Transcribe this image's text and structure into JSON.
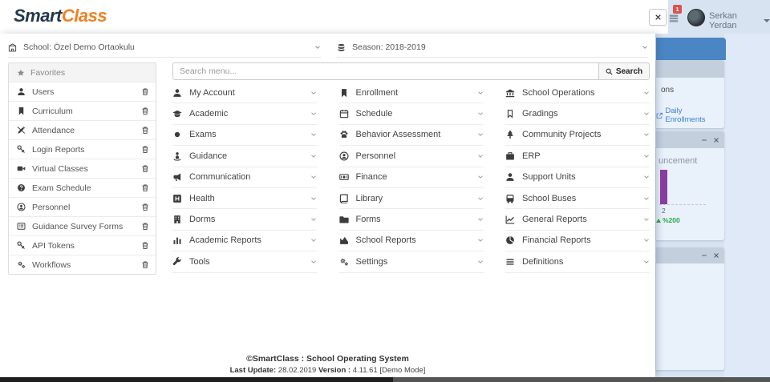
{
  "header": {
    "logo_part1": "Smart",
    "logo_part2": "Class",
    "user_name": "Serkan Yerdan",
    "notification_count": "1"
  },
  "context": {
    "school_label": "School: Özel Demo Ortaokulu",
    "season_label": "Season: 2018-2019"
  },
  "favorites": {
    "title": "Favorites",
    "items": [
      {
        "label": "Users",
        "icon": "user"
      },
      {
        "label": "Curriculum",
        "icon": "bookmark"
      },
      {
        "label": "Attendance",
        "icon": "pencil-slash"
      },
      {
        "label": "Login Reports",
        "icon": "key"
      },
      {
        "label": "Virtual Classes",
        "icon": "video"
      },
      {
        "label": "Exam Schedule",
        "icon": "question-circle"
      },
      {
        "label": "Personnel",
        "icon": "user-circle"
      },
      {
        "label": "Guidance Survey Forms",
        "icon": "list-alt"
      },
      {
        "label": "API Tokens",
        "icon": "key"
      },
      {
        "label": "Workflows",
        "icon": "cogs"
      }
    ]
  },
  "search": {
    "placeholder": "Search menu...",
    "button_label": "Search"
  },
  "menu": {
    "items": [
      {
        "label": "My Account",
        "icon": "user"
      },
      {
        "label": "Enrollment",
        "icon": "bookmark"
      },
      {
        "label": "School Operations",
        "icon": "bank"
      },
      {
        "label": "Academic",
        "icon": "grad-cap"
      },
      {
        "label": "Schedule",
        "icon": "calendar"
      },
      {
        "label": "Gradings",
        "icon": "bookmark-o"
      },
      {
        "label": "Exams",
        "icon": "circle"
      },
      {
        "label": "Behavior Assessment",
        "icon": "paw"
      },
      {
        "label": "Community Projects",
        "icon": "tree"
      },
      {
        "label": "Guidance",
        "icon": "guidance"
      },
      {
        "label": "Personnel",
        "icon": "user-circle"
      },
      {
        "label": "ERP",
        "icon": "briefcase"
      },
      {
        "label": "Communication",
        "icon": "bullhorn"
      },
      {
        "label": "Finance",
        "icon": "money"
      },
      {
        "label": "Support Units",
        "icon": "user"
      },
      {
        "label": "Health",
        "icon": "hospital"
      },
      {
        "label": "Library",
        "icon": "book"
      },
      {
        "label": "School Buses",
        "icon": "bus"
      },
      {
        "label": "Dorms",
        "icon": "building"
      },
      {
        "label": "Forms",
        "icon": "folder"
      },
      {
        "label": "General Reports",
        "icon": "line-chart"
      },
      {
        "label": "Academic Reports",
        "icon": "bar-chart"
      },
      {
        "label": "School Reports",
        "icon": "area-chart"
      },
      {
        "label": "Financial Reports",
        "icon": "pie-chart"
      },
      {
        "label": "Tools",
        "icon": "wrench"
      },
      {
        "label": "Settings",
        "icon": "cogs"
      },
      {
        "label": "Definitions",
        "icon": "list"
      }
    ]
  },
  "footer": {
    "copyright": "©SmartClass : School Operating System",
    "last_update_label": "Last Update:",
    "last_update_value": "28.02.2019",
    "version_label": "Version :",
    "version_value": "4.11.61 [Demo Mode]"
  },
  "background": {
    "card1": {
      "partial_text": "ons",
      "link_label": "Daily Enrollments"
    },
    "card2": {
      "partial_text": "uncement",
      "bar_value": "2",
      "percent_label": "%200"
    }
  },
  "colors": {
    "logo_navy": "#24384a",
    "accent_orange": "#ef8123",
    "badge_red": "#d9534f",
    "link_blue": "#3e7ed8",
    "bar_purple": "#8a3ca3",
    "percent_green": "#28a745",
    "panel_blue": "#4a86c4"
  }
}
